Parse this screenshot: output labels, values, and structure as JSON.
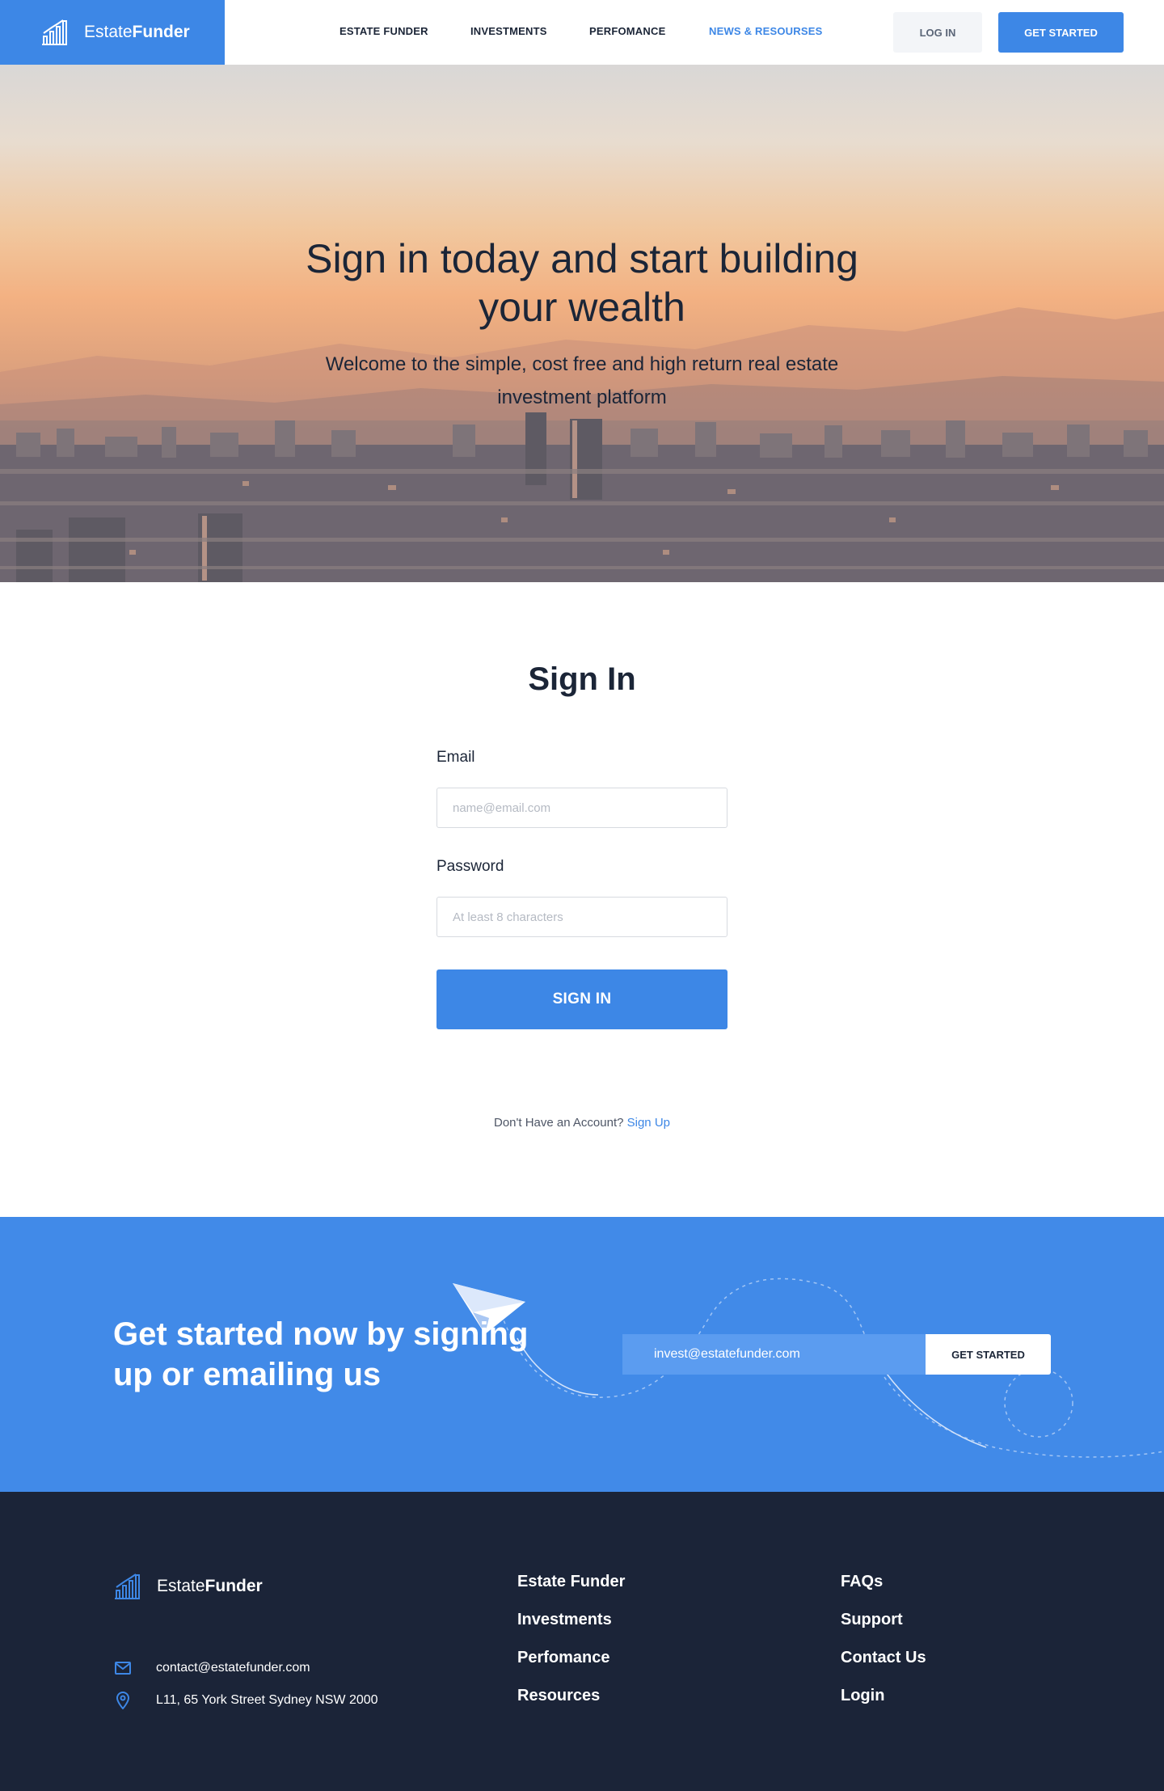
{
  "brand": {
    "light": "Estate",
    "bold": "Funder"
  },
  "nav": {
    "items": [
      {
        "label": "ESTATE FUNDER",
        "active": false
      },
      {
        "label": "INVESTMENTS",
        "active": false
      },
      {
        "label": "PERFOMANCE",
        "active": false
      },
      {
        "label": "NEWS & RESOURSES",
        "active": true
      }
    ],
    "login_label": "LOG IN",
    "get_started_label": "GET STARTED"
  },
  "hero": {
    "title_line1": "Sign in today and start building",
    "title_line2": "your wealth",
    "subtitle_line1": "Welcome to the simple, cost free and high return real estate",
    "subtitle_line2": "investment platform"
  },
  "signin": {
    "title": "Sign In",
    "email_label": "Email",
    "email_placeholder": "name@email.com",
    "password_label": "Password",
    "password_placeholder": "At least 8 characters",
    "submit_label": "SIGN IN",
    "no_account_text": "Don't Have an Account?",
    "signup_link": "Sign Up"
  },
  "cta": {
    "title_line1": "Get started now by signing",
    "title_line2": "up or emailing us",
    "email_value": "invest@estatefunder.com",
    "button_label": "GET STARTED"
  },
  "footer": {
    "email": "contact@estatefunder.com",
    "address": "L11, 65 York Street Sydney NSW 2000",
    "col1": [
      "Estate Funder",
      "Investments",
      "Perfomance",
      "Resources"
    ],
    "col2": [
      "FAQs",
      "Support",
      "Contact Us",
      "Login"
    ]
  },
  "colors": {
    "primary": "#3d87e6",
    "cta_bg": "#418ae8",
    "footer_bg": "#1b2438",
    "text_dark": "#1b2537"
  },
  "icons": [
    "bar-chart-logo-icon",
    "paper-plane-icon",
    "mail-icon",
    "map-pin-icon"
  ]
}
